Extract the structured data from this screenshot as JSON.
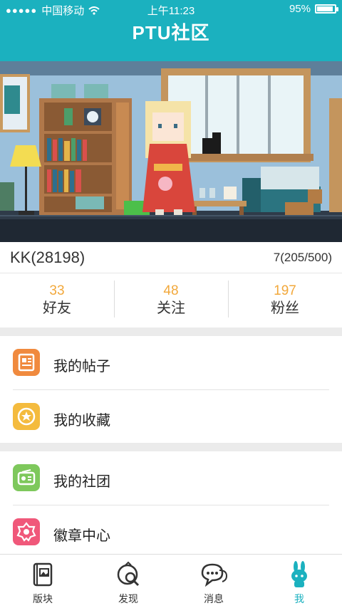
{
  "status_bar": {
    "carrier": "中国移动",
    "time": "上午11:23",
    "battery": "95%"
  },
  "header": {
    "title": "PTU社区"
  },
  "profile": {
    "username": "KK(28198)",
    "level": "7(205/500)"
  },
  "stats": [
    {
      "count": "33",
      "label": "好友"
    },
    {
      "count": "48",
      "label": "关注"
    },
    {
      "count": "197",
      "label": "粉丝"
    }
  ],
  "menu": [
    {
      "label": "我的帖子",
      "icon": "post-icon",
      "color": "#f08a3e"
    },
    {
      "label": "我的收藏",
      "icon": "favorite-icon",
      "color": "#f4bb3e"
    },
    {
      "label": "我的社团",
      "icon": "club-icon",
      "color": "#7ec85c"
    },
    {
      "label": "徽章中心",
      "icon": "badge-icon",
      "color": "#f0587a"
    }
  ],
  "tabs": [
    {
      "label": "版块",
      "icon": "board-icon"
    },
    {
      "label": "发现",
      "icon": "discover-icon"
    },
    {
      "label": "消息",
      "icon": "message-icon"
    },
    {
      "label": "我",
      "icon": "me-rabbit-icon",
      "active": true
    }
  ],
  "colors": {
    "brand": "#1bb1bf",
    "count": "#f2a83b"
  }
}
